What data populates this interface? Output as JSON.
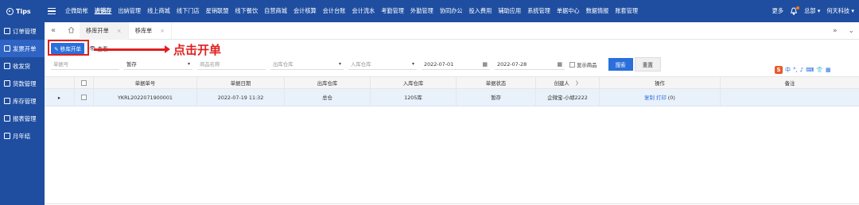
{
  "brand": {
    "title": "Tips"
  },
  "nav": {
    "items": [
      "企微助帐",
      "进销存",
      "出纳管理",
      "线上商城",
      "线下门店",
      "星销联盟",
      "线下餐饮",
      "自营商城",
      "会计核算",
      "会计台账",
      "会计流水",
      "考勤管理",
      "外勤管理",
      "协同办公",
      "投入费用",
      "辅助应用",
      "系统管理",
      "单据中心",
      "数据情报",
      "账套管理"
    ],
    "active_index": 1,
    "more_label": "更多",
    "user_label": "总部 ▾",
    "company_label": "何天科技 ▾"
  },
  "sidebar": {
    "items": [
      "订单管理",
      "发票开单",
      "收发货",
      "货款管理",
      "库存管理",
      "报表管理",
      "月年结"
    ],
    "active_index": 1
  },
  "tabs": {
    "home_icon": "home-icon",
    "items": [
      {
        "label": "移库开单",
        "close": "×"
      },
      {
        "label": "移库单",
        "close": "×"
      }
    ],
    "active_index": 0
  },
  "toolbar": {
    "new_label": "移库开单",
    "view_label": "查看"
  },
  "callout": {
    "text": "点击开单",
    "color": "#e02020"
  },
  "filters": {
    "doc_no_placeholder": "单据号",
    "status_value": "暂存",
    "product_placeholder": "商品名称",
    "out_wh_placeholder": "出库仓库",
    "in_wh_placeholder": "入库仓库",
    "date_from": "2022-07-01",
    "date_to": "2022-07-28",
    "show_goods_label": "显示商品",
    "search_label": "搜索",
    "reset_label": "重置"
  },
  "ime": {
    "items": [
      "中",
      "°,",
      "♪",
      "⌨",
      "👕",
      "▦"
    ]
  },
  "table": {
    "headers": [
      "",
      "",
      "单据单号",
      "单据日期",
      "出库仓库",
      "入库仓库",
      "单据状态",
      "创建人",
      "操作",
      "备注"
    ],
    "rows": [
      {
        "expander": "▸",
        "doc_no": "YKRL2022071900001",
        "date": "2022-07-19 11:32",
        "out_wh": "总仓",
        "in_wh": "1205库",
        "status": "暂存",
        "creator": "企微宝-小胡2222",
        "op_copy": "复制",
        "op_print": "打印",
        "op_count": "(0)",
        "remark": ""
      }
    ]
  },
  "colors": {
    "nav_bg": "#1f4ea1",
    "primary": "#2a6fdb",
    "highlight": "#e02020"
  }
}
